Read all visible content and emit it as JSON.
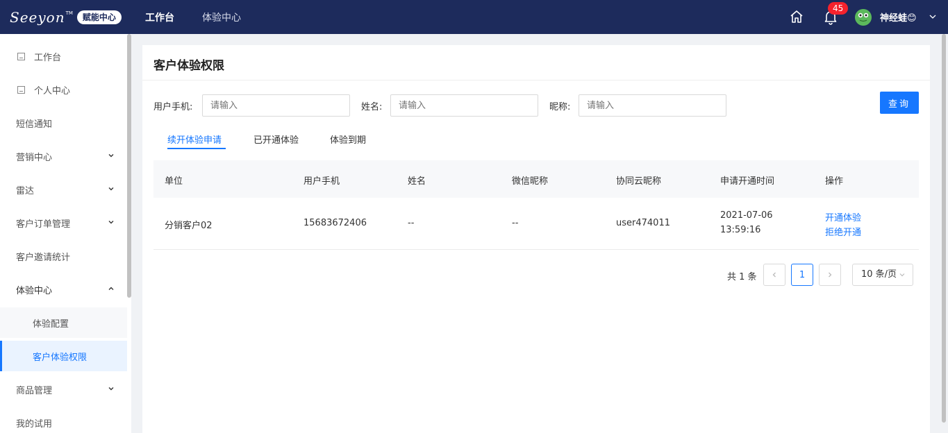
{
  "header": {
    "logo_text": "Seeyon",
    "logo_tm": "TM",
    "logo_badge": "赋能中心",
    "nav": [
      {
        "label": "工作台",
        "active": true
      },
      {
        "label": "体验中心",
        "active": false
      }
    ],
    "notification_count": "45",
    "username": "神经蛙😊",
    "icons": [
      "home-icon",
      "bell-icon",
      "avatar",
      "chevron-down-icon"
    ],
    "background_color": "#1d2b5c",
    "badge_color": "#f5222d"
  },
  "sidebar": {
    "items": [
      {
        "label": "工作台",
        "icon": "page-icon"
      },
      {
        "label": "个人中心",
        "icon": "page-icon"
      },
      {
        "label": "短信通知"
      },
      {
        "label": "营销中心",
        "expand": "collapsed"
      },
      {
        "label": "雷达",
        "expand": "collapsed"
      },
      {
        "label": "客户订单管理",
        "expand": "collapsed"
      },
      {
        "label": "客户邀请统计"
      },
      {
        "label": "体验中心",
        "expand": "expanded"
      },
      {
        "label": "体验配置",
        "sub": true
      },
      {
        "label": "客户体验权限",
        "sub": true,
        "selected": true
      },
      {
        "label": "商品管理",
        "expand": "collapsed"
      },
      {
        "label": "我的试用"
      }
    ],
    "accent_color": "#1677ff"
  },
  "main": {
    "title": "客户体验权限",
    "filters": [
      {
        "label": "用户手机:",
        "placeholder": "请输入"
      },
      {
        "label": "姓名:",
        "placeholder": "请输入"
      },
      {
        "label": "昵称:",
        "placeholder": "请输入"
      }
    ],
    "query_button": "查询",
    "tabs": [
      {
        "label": "续开体验申请",
        "active": true
      },
      {
        "label": "已开通体验",
        "active": false
      },
      {
        "label": "体验到期",
        "active": false
      }
    ],
    "table": {
      "headers": [
        "单位",
        "用户手机",
        "姓名",
        "微信昵称",
        "协同云昵称",
        "申请开通时间",
        "操作"
      ],
      "rows": [
        {
          "unit": "分销客户02",
          "phone": "15683672406",
          "name": "--",
          "wechat": "--",
          "cloud_nick": "user474011",
          "apply_date": "2021-07-06",
          "apply_time": "13:59:16",
          "actions": [
            "开通体验",
            "拒绝开通"
          ]
        }
      ]
    },
    "pagination": {
      "total": "共 1 条",
      "current_page": "1",
      "page_size": "10 条/页",
      "prev_icon": "chevron-left-icon",
      "next_icon": "chevron-right-icon"
    }
  }
}
